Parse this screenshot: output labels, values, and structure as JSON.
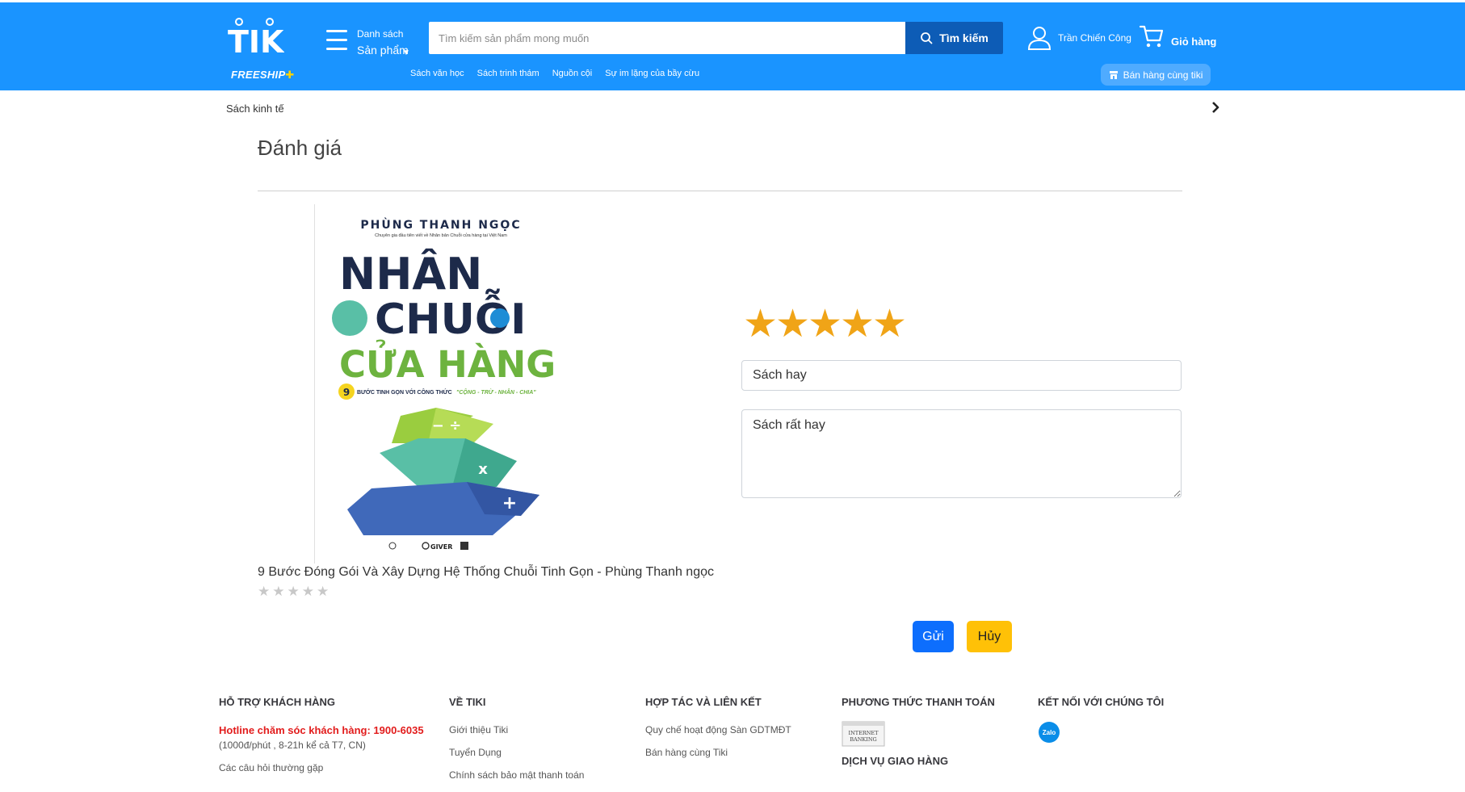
{
  "header": {
    "logo_text": "TIKI",
    "freeship_label": "FREESHIP",
    "menu": {
      "line1": "Danh sách",
      "line2": "Sản phẩm"
    },
    "search": {
      "placeholder": "Tìm kiếm sản phẩm mong muốn",
      "value": "",
      "button_label": "Tìm kiếm"
    },
    "quick_links": [
      "Sách văn học",
      "Sách trinh thám",
      "Nguồn cội",
      "Sự im lặng của bầy cừu"
    ],
    "user_name": "Trần Chiến Công",
    "cart_label": "Giỏ hàng",
    "seller_button_label": "Bán hàng cùng tiki"
  },
  "breadcrumb": "Sách kinh tế",
  "page_title": "Đánh giá",
  "product": {
    "name": "9 Bước Đóng Gói Và Xây Dựng Hệ Thống Chuỗi Tinh Gọn - Phùng Thanh ngọc",
    "star_count": 5,
    "cover": {
      "author": "PHÙNG THANH NGỌC",
      "subtitle": "Chuyên gia đầu tiên viết về Nhân bản Chuỗi cửa hàng tại Việt Nam",
      "title_line1": "NHÂN",
      "title_line2": "CHUỖI",
      "title_line3": "CỬA HÀNG",
      "tagline_number": "9",
      "tagline": "BƯỚC TINH GỌN VỚI CÔNG THỨC",
      "tagline_formula": "\"CỘNG - TRỪ - NHÂN - CHIA\"",
      "pyramid_top": "− ÷",
      "pyramid_mid": "x",
      "pyramid_bottom": "+",
      "publisher": "GIVER"
    }
  },
  "review": {
    "rating": 5,
    "title_value": "Sách hay",
    "content_value": "Sách rất hay",
    "send_label": "Gửi",
    "cancel_label": "Hủy"
  },
  "footer": {
    "support": {
      "heading": "HỖ TRỢ KHÁCH HÀNG",
      "hotline": "Hotline chăm sóc khách hàng: 1900-6035",
      "hotline_note": "(1000đ/phút , 8-21h kể cả T7, CN)",
      "faq": "Các câu hỏi thường gặp"
    },
    "about": {
      "heading": "VỀ TIKI",
      "links": [
        "Giới thiệu Tiki",
        "Tuyển Dụng",
        "Chính sách bảo mật thanh toán"
      ]
    },
    "partners": {
      "heading": "HỢP TÁC VÀ LIÊN KẾT",
      "links": [
        "Quy chế hoạt động Sàn GDTMĐT",
        "Bán hàng cùng Tiki"
      ]
    },
    "payment": {
      "heading": "PHƯƠNG THỨC THANH TOÁN",
      "badge_text": "INTERNET BANKING",
      "delivery_heading": "DỊCH VỤ GIAO HÀNG"
    },
    "connect": {
      "heading": "KẾT NỐI VỚI CHÚNG TÔI",
      "zalo": "Zalo"
    }
  },
  "colors": {
    "header_bg": "#1a94ff",
    "search_button": "#0d5cb6",
    "star_active": "#f0a417",
    "send_button": "#0d6efd",
    "cancel_button": "#ffc107",
    "hotline": "#e21c1c"
  }
}
